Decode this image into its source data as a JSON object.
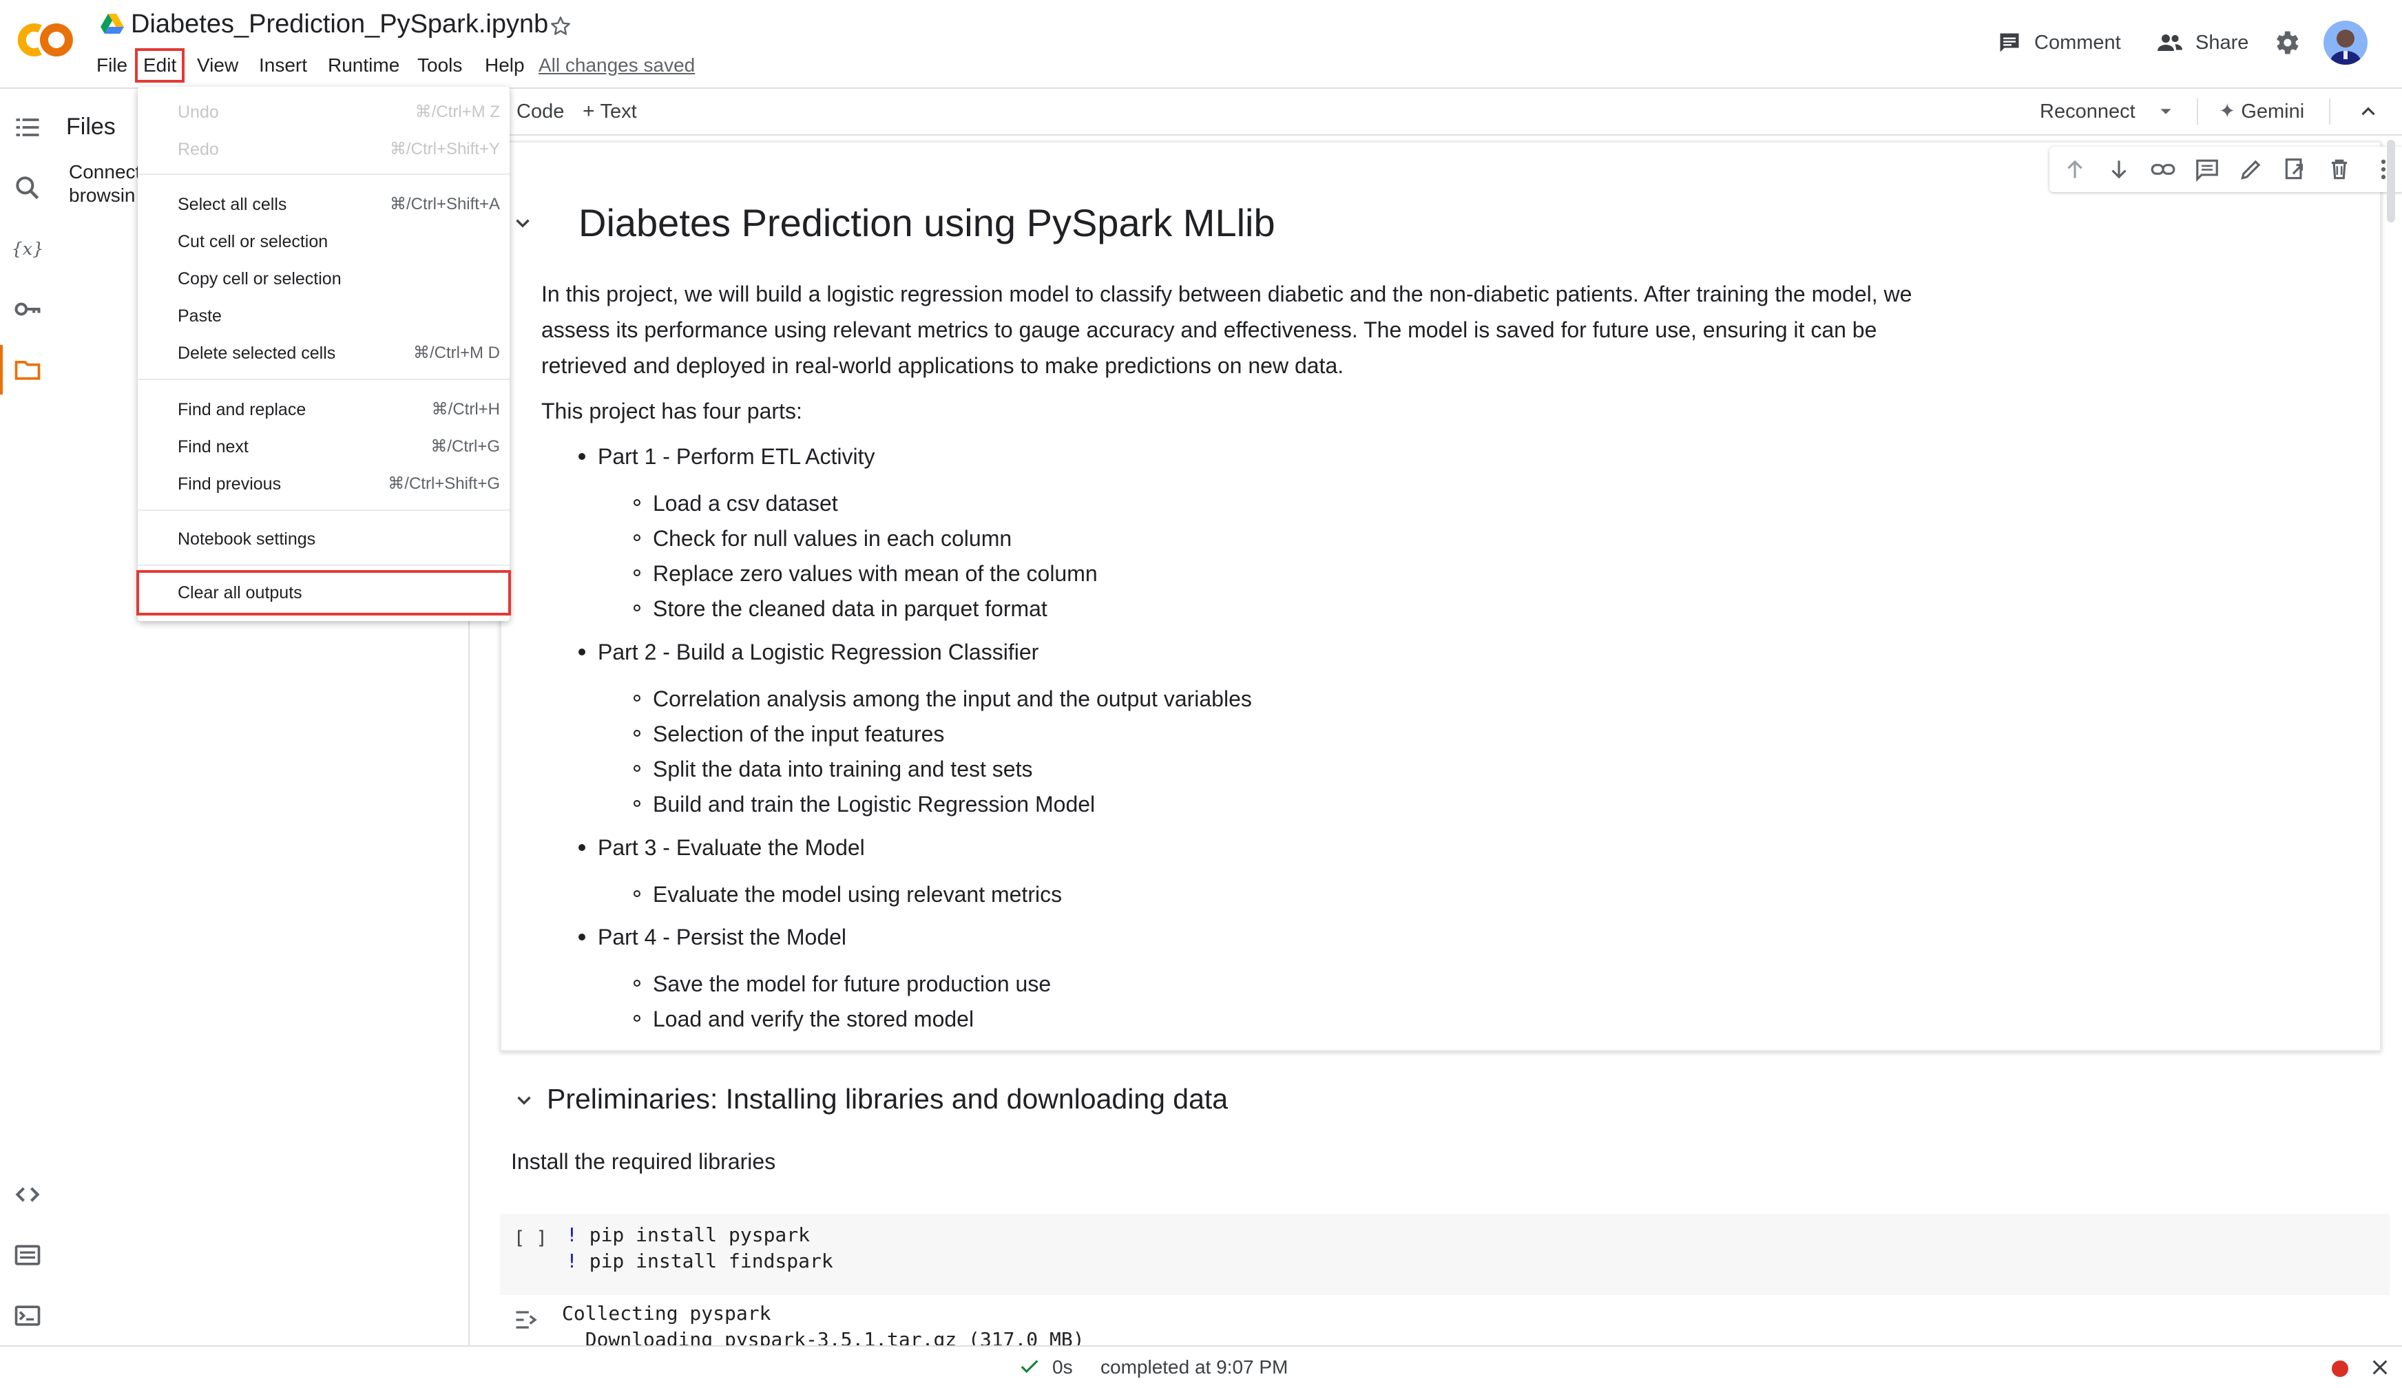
{
  "app": {
    "notebook_title": "Diabetes_Prediction_PySpark.ipynb",
    "logo_text": "CO",
    "saved_status": "All changes saved"
  },
  "menubar": {
    "items": [
      "File",
      "Edit",
      "View",
      "Insert",
      "Runtime",
      "Tools",
      "Help"
    ]
  },
  "header_actions": {
    "comment_label": "Comment",
    "share_label": "Share"
  },
  "files_panel": {
    "title": "Files",
    "text_line1": "Connect",
    "text_line2": "browsin"
  },
  "toolbar": {
    "add_code_label": "Code",
    "add_text_label": "Text",
    "reconnect_label": "Reconnect",
    "gemini_label": "Gemini"
  },
  "edit_menu": {
    "items": [
      {
        "label": "Undo",
        "shortcut": "⌘/Ctrl+M Z",
        "disabled": true
      },
      {
        "label": "Redo",
        "shortcut": "⌘/Ctrl+Shift+Y",
        "disabled": true
      },
      {
        "label": "Select all cells",
        "shortcut": "⌘/Ctrl+Shift+A"
      },
      {
        "label": "Cut cell or selection",
        "shortcut": ""
      },
      {
        "label": "Copy cell or selection",
        "shortcut": ""
      },
      {
        "label": "Paste",
        "shortcut": ""
      },
      {
        "label": "Delete selected cells",
        "shortcut": "⌘/Ctrl+M D"
      },
      {
        "label": "Find and replace",
        "shortcut": "⌘/Ctrl+H"
      },
      {
        "label": "Find next",
        "shortcut": "⌘/Ctrl+G"
      },
      {
        "label": "Find previous",
        "shortcut": "⌘/Ctrl+Shift+G"
      },
      {
        "label": "Notebook settings",
        "shortcut": ""
      },
      {
        "label": "Clear all outputs",
        "shortcut": ""
      }
    ]
  },
  "notebook": {
    "heading": "Diabetes Prediction using PySpark MLlib",
    "intro_line1": "In this project, we will build a logistic regression model to classify between diabetic and the non-diabetic patients. After training the model, we",
    "intro_line2": "assess its performance using relevant metrics to gauge accuracy and effectiveness. The model is saved for future use, ensuring it can be",
    "intro_line3": "retrieved and deployed in real-world applications to make predictions on new data.",
    "parts_intro": "This project has four parts:",
    "parts": [
      {
        "title": "Part 1 - Perform ETL Activity",
        "items": [
          "Load a csv dataset",
          "Check for null values in each column",
          "Replace zero values with mean of the column",
          "Store the cleaned data in parquet format"
        ]
      },
      {
        "title": "Part 2 - Build a Logistic Regression Classifier",
        "items": [
          "Correlation analysis among the input and the output variables",
          "Selection of the input features",
          "Split the data into training and test sets",
          "Build and train the Logistic Regression Model"
        ]
      },
      {
        "title": "Part 3 - Evaluate the Model",
        "items": [
          "Evaluate the model using relevant metrics"
        ]
      },
      {
        "title": "Part 4 - Persist the Model",
        "items": [
          "Save the model for future production use",
          "Load and verify the stored model"
        ]
      }
    ],
    "section_heading": "Preliminaries: Installing libraries and downloading data",
    "install_text": "Install the required libraries",
    "code_cell": {
      "run_indicator": "[ ]",
      "lines": [
        {
          "bang": "!",
          "code": " pip install pyspark"
        },
        {
          "bang": "!",
          "code": " pip install findspark"
        }
      ],
      "output_lines": [
        "Collecting pyspark",
        "  Downloading pyspark-3.5.1.tar.gz (317.0 MB)"
      ]
    }
  },
  "statusbar": {
    "duration": "0s",
    "completed_text": "completed at 9:07 PM"
  },
  "colors": {
    "highlight_red": "#e53935",
    "logo_orange": "#f9ab00",
    "logo_dark_orange": "#e8710a",
    "accent_orange": "#e8710a",
    "bang_blue": "#1a1aa6"
  },
  "icons": {
    "rail": [
      "toc-icon",
      "search-icon",
      "variables-icon",
      "key-icon",
      "folder-icon",
      "code-snippets-icon",
      "command-palette-icon",
      "terminal-icon"
    ],
    "cell_toolbar": [
      "arrow-up-icon",
      "arrow-down-icon",
      "link-icon",
      "comment-icon",
      "edit-icon",
      "mirror-cell-icon",
      "delete-icon",
      "more-vert-icon"
    ]
  }
}
